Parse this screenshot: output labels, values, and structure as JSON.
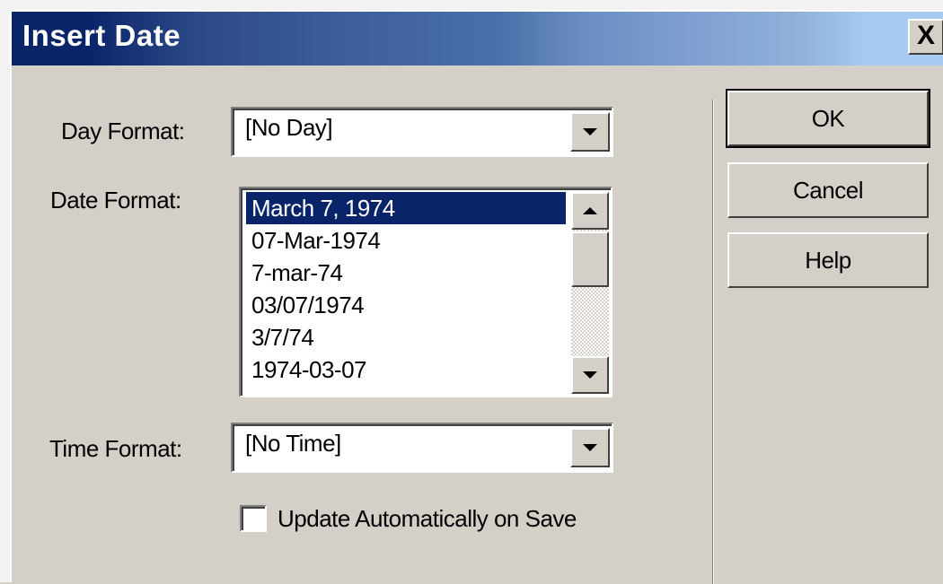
{
  "dialog": {
    "title": "Insert Date",
    "close_glyph": "X"
  },
  "day_format": {
    "label": "Day Format:",
    "value": "[No Day]"
  },
  "date_format": {
    "label": "Date Format:",
    "options": [
      "March 7, 1974",
      "07-Mar-1974",
      "7-mar-74",
      "03/07/1974",
      "3/7/74",
      "1974-03-07"
    ],
    "selected": "March 7, 1974"
  },
  "time_format": {
    "label": "Time Format:",
    "value": "[No Time]"
  },
  "update_checkbox": {
    "label": "Update Automatically on Save",
    "checked": false
  },
  "buttons": {
    "ok": "OK",
    "cancel": "Cancel",
    "help": "Help"
  },
  "colors": {
    "title_bar_start": "#0a246a",
    "title_bar_end": "#a6caf0",
    "dialog_face": "#d4d0c8",
    "selection": "#0a246a"
  },
  "icons": {
    "close": "close-icon",
    "dropdown": "chevron-down-icon",
    "scroll_up": "scroll-up-icon",
    "scroll_down": "scroll-down-icon"
  }
}
